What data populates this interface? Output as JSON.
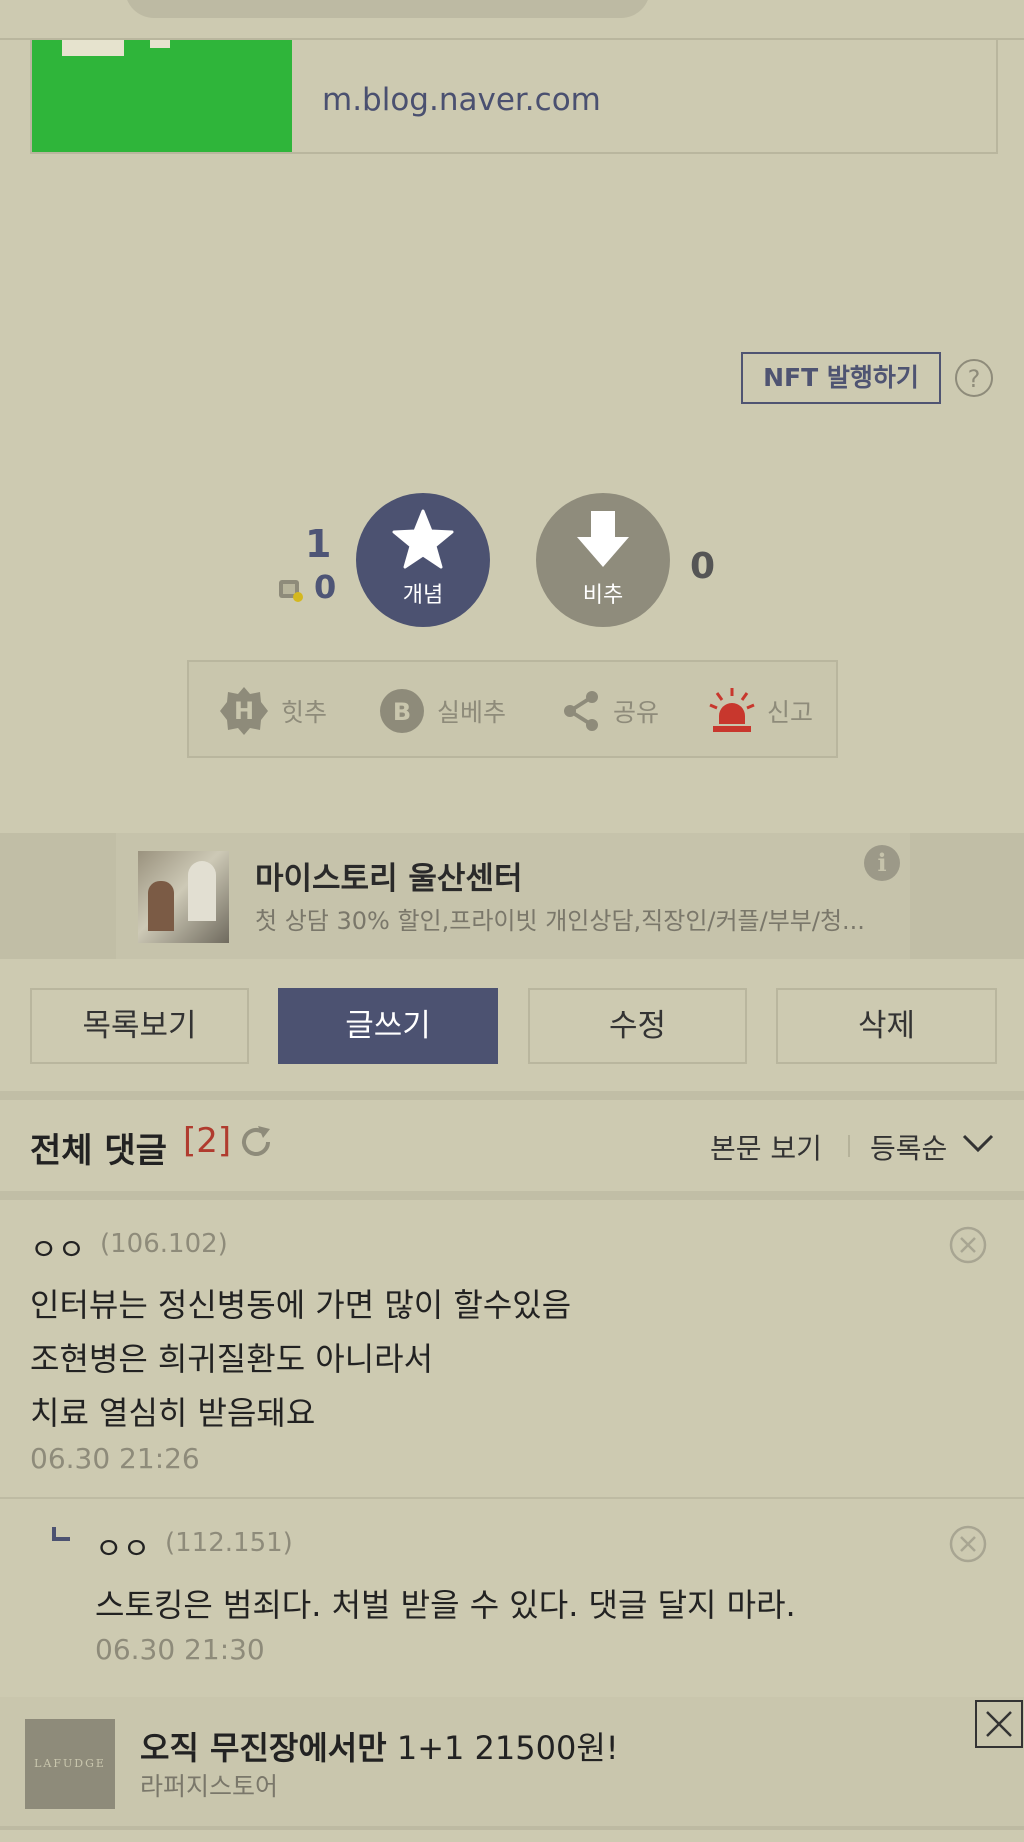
{
  "link_card": {
    "url": "m.blog.naver.com"
  },
  "nft": {
    "button_label": "NFT 발행하기",
    "help_glyph": "?"
  },
  "votes": {
    "recommend_count": "1",
    "fixed_recommend_count": "0",
    "up_label": "개념",
    "down_label": "비추",
    "down_count": "0"
  },
  "actions": [
    {
      "label": "힛추",
      "icon": "hit-icon"
    },
    {
      "label": "실베추",
      "icon": "best-icon"
    },
    {
      "label": "공유",
      "icon": "share-icon"
    },
    {
      "label": "신고",
      "icon": "siren-icon"
    }
  ],
  "ad": {
    "title": "마이스토리 울산센터",
    "description": "첫 상담 30% 할인,프라이빗 개인상담,직장인/커플/부부/청...",
    "info_glyph": "i"
  },
  "buttons": {
    "list": "목록보기",
    "write": "글쓰기",
    "edit": "수정",
    "delete": "삭제"
  },
  "comments_header": {
    "title": "전체 댓글",
    "count": "[2]",
    "view_body": "본문 보기",
    "sort": "등록순"
  },
  "comments": [
    {
      "name": "ㅇㅇ",
      "ip": "(106.102)",
      "lines": [
        "인터뷰는 정신병동에 가면 많이 할수있음",
        "조현병은 희귀질환도 아니라서",
        "치료 열심히 받음돼요"
      ],
      "date": "06.30 21:26"
    },
    {
      "name": "ㅇㅇ",
      "ip": "(112.151)",
      "lines": [
        "스토킹은 범죄다. 처벌 받을 수 있다. 댓글 달지 마라."
      ],
      "date": "06.30 21:30",
      "reply": true
    }
  ],
  "bottom_ad": {
    "logo": "LAFUDGE",
    "title_bold": "오직 무진장에서만",
    "title_rest": " 1+1 21500원!",
    "subtitle": "라퍼지스토어"
  },
  "colors": {
    "primary": "#4c5271",
    "background": "#cdcab1",
    "link_thumb": "#2fb53a",
    "alert": "#c8372d"
  }
}
